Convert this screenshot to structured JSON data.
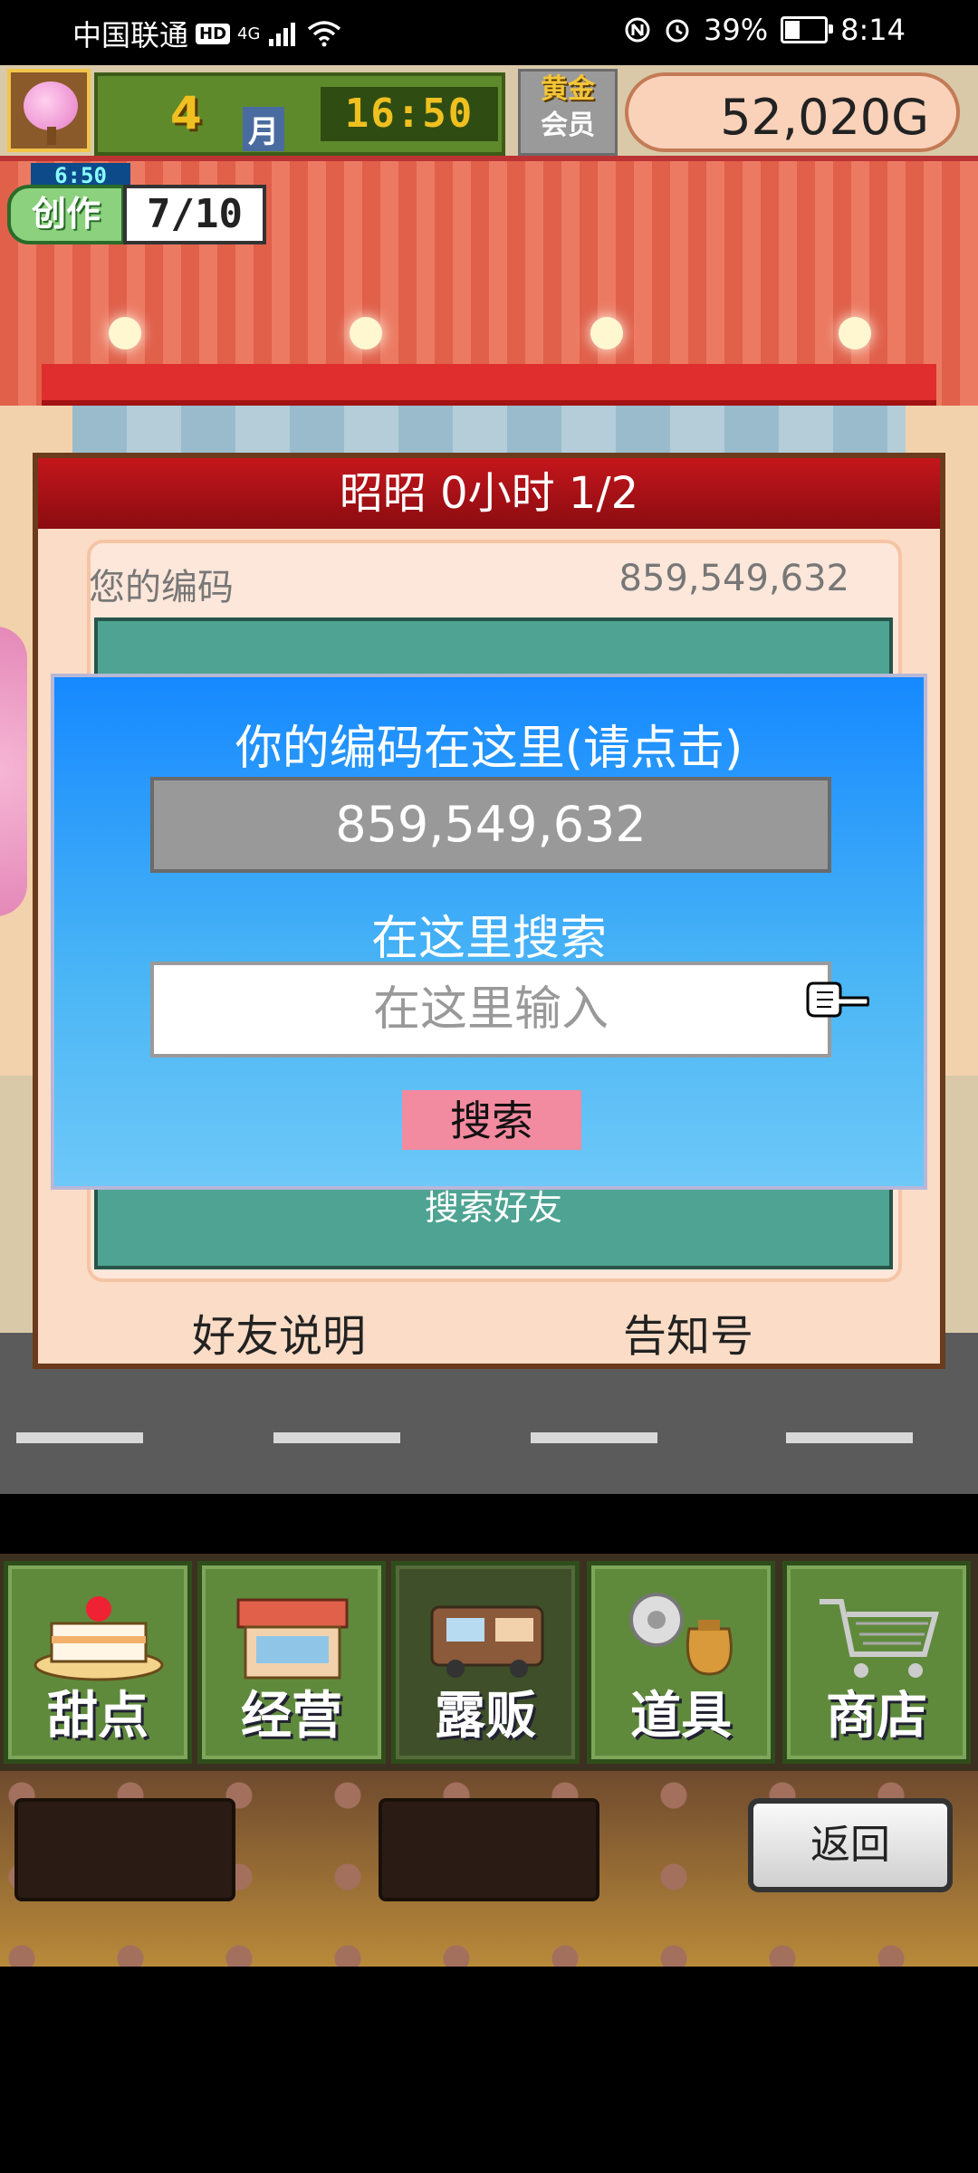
{
  "status_bar": {
    "carrier": "中国联通",
    "hd_badge": "HD",
    "network": "4G",
    "battery_percent": "39%",
    "time": "8:14",
    "battery_level": 0.39
  },
  "hud": {
    "month_number": "4",
    "month_label": "月",
    "game_time": "16:50",
    "member_line1": "黄金",
    "member_line2": "会员",
    "money": "52,020G"
  },
  "create_badge": {
    "timer": "6:50",
    "label": "创作",
    "count": "7/10"
  },
  "friend_panel": {
    "header": "昭昭  0小时 1/2",
    "your_code_label": "您的编码",
    "your_code_value": "859,549,632",
    "search_friend_label": "搜索好友",
    "link_friend_info": "好友说明",
    "link_notify": "告知号"
  },
  "dialog": {
    "title": "你的编码在这里(请点击)",
    "code": "859,549,632",
    "search_title": "在这里搜索",
    "input_placeholder": "在这里输入",
    "search_button": "搜索"
  },
  "menu": {
    "items": [
      {
        "label": "甜点",
        "icon": "cake-icon"
      },
      {
        "label": "经营",
        "icon": "shop-icon"
      },
      {
        "label": "露贩",
        "icon": "food-truck-icon"
      },
      {
        "label": "道具",
        "icon": "items-bag-icon"
      },
      {
        "label": "商店",
        "icon": "cart-icon"
      }
    ],
    "back_button": "返回"
  }
}
